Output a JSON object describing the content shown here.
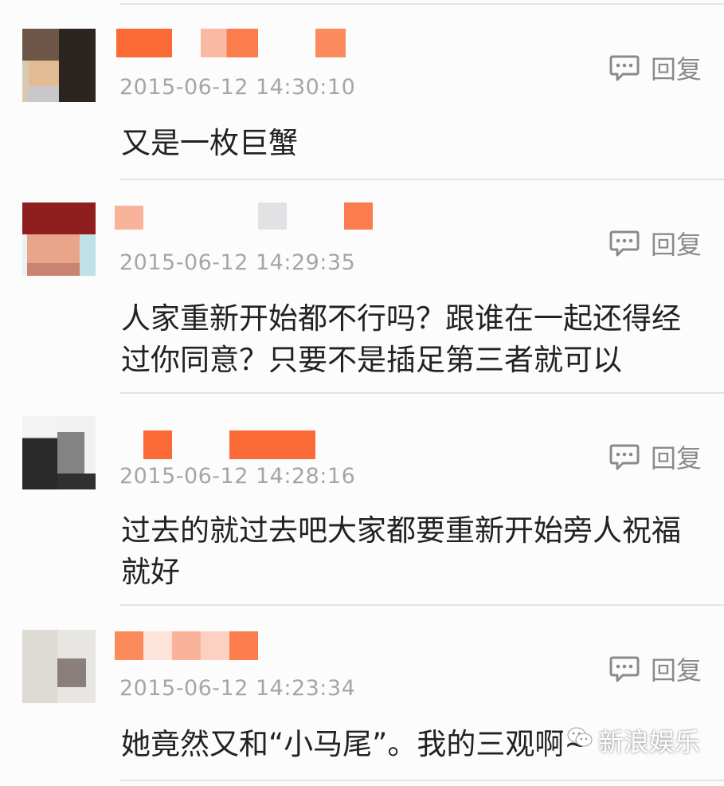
{
  "colors": {
    "accent": "#fb6a36",
    "timestamp": "#a5a5a9",
    "divider": "#e3e2e6",
    "text": "#222222"
  },
  "reply_label": "回复",
  "comments": [
    {
      "timestamp": "2015-06-12 14:30:10",
      "text": "又是一枚巨蟹"
    },
    {
      "timestamp": "2015-06-12 14:29:35",
      "text": "人家重新开始都不行吗？跟谁在一起还得经过你同意？只要不是插足第三者就可以"
    },
    {
      "timestamp": "2015-06-12 14:28:16",
      "text": "过去的就过去吧大家都要重新开始旁人祝福就好"
    },
    {
      "timestamp": "2015-06-12 14:23:34",
      "text": "她竟然又和“小马尾”。我的三观啊~"
    }
  ],
  "watermark": {
    "label": "新浪娱乐",
    "icon": "wechat-icon"
  }
}
